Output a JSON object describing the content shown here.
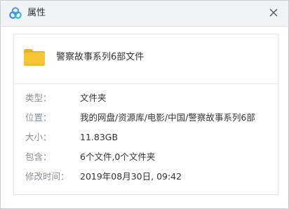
{
  "dialog": {
    "title": "属性",
    "logo_icon": "baidu-netdisk-logo-icon",
    "close_icon": "close-icon"
  },
  "file": {
    "icon": "folder-icon",
    "name": "警察故事系列6部文件"
  },
  "properties": [
    {
      "label": "类型：",
      "value": "文件夹"
    },
    {
      "label": "位置：",
      "value": "我的网盘/资源库/电影/中国/警察故事系列6部"
    },
    {
      "label": "大小：",
      "value": "11.83GB"
    },
    {
      "label": "包含：",
      "value": "6个文件,0个文件夹"
    },
    {
      "label": "修改时间：",
      "value": "2019年08月30日, 09:42"
    }
  ],
  "colors": {
    "folder": "#f7c633",
    "logo_blue": "#3b8cf6",
    "logo_teal": "#28c4c4",
    "label": "#8a8f98",
    "text": "#333333"
  }
}
